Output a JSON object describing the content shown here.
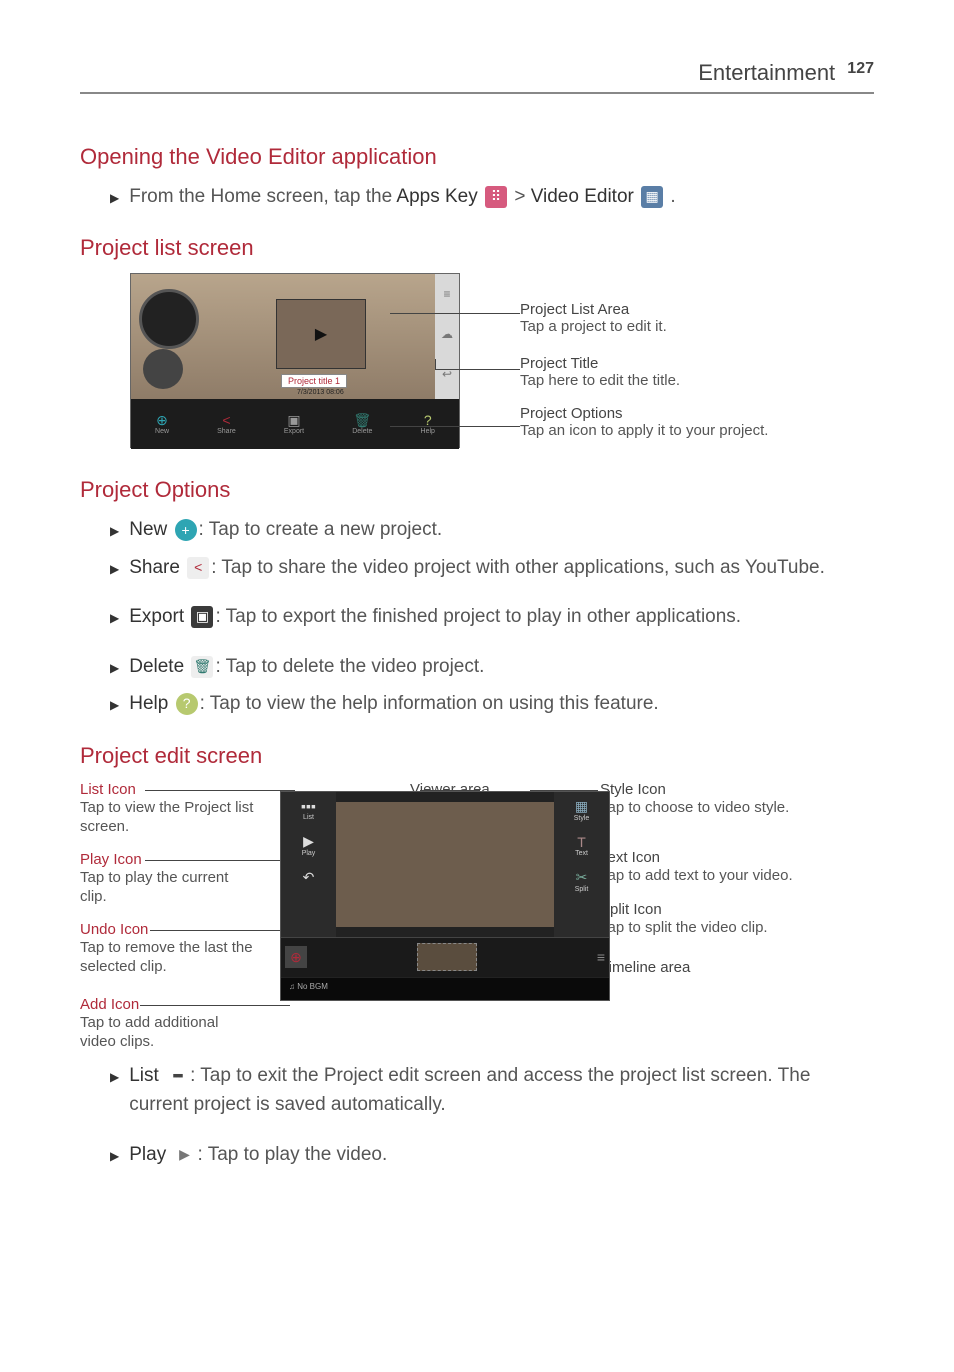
{
  "header": {
    "section": "Entertainment",
    "page": "127"
  },
  "h1": "Opening the Video Editor application",
  "intro": {
    "p1": "From the Home screen, tap the ",
    "apps": "Apps Key",
    "sep": " > ",
    "video": "Video Editor",
    "end": "."
  },
  "h2": "Project list screen",
  "diagram1": {
    "proj_title": "Project title 1",
    "proj_date": "7/3/2013 08:06",
    "btns": [
      {
        "ico": "⊕",
        "lbl": "New"
      },
      {
        "ico": "<",
        "lbl": "Share"
      },
      {
        "ico": "▣",
        "lbl": "Export"
      },
      {
        "ico": "🗑",
        "lbl": "Delete"
      },
      {
        "ico": "?",
        "lbl": "Help"
      }
    ],
    "c1t": "Project List Area",
    "c1d": "Tap a project to edit it.",
    "c2t": "Project Title",
    "c2d": "Tap here to edit the title.",
    "c3t": "Project Options",
    "c3d": "Tap an icon to apply it to your project."
  },
  "h3": "Project Options",
  "opts": {
    "new": {
      "label": "New",
      "desc": ": Tap to create a new project."
    },
    "share": {
      "label": "Share",
      "desc": ": Tap to share the video project with other applications, such as YouTube."
    },
    "export": {
      "label": "Export",
      "desc": ": Tap to export the finished project to play in other applications."
    },
    "delete": {
      "label": "Delete",
      "desc": ": Tap to delete the video project."
    },
    "help": {
      "label": "Help",
      "desc": ": Tap to view the help information on using this feature."
    }
  },
  "h4": "Project edit screen",
  "diagram2": {
    "list": {
      "t": "List Icon",
      "d": "Tap to view the Project list screen."
    },
    "play": {
      "t": "Play Icon",
      "d": "Tap to play the current clip."
    },
    "undo": {
      "t": "Undo Icon",
      "d": "Tap to remove the last the selected clip."
    },
    "add": {
      "t": "Add Icon",
      "d": "Tap to add additional video clips."
    },
    "viewer": {
      "t": "Viewer area"
    },
    "style": {
      "t": "Style Icon",
      "d": "Tap to choose to video style."
    },
    "text": {
      "t": "Text Icon",
      "d": "Tap to add text to your video."
    },
    "split": {
      "t": "Split Icon",
      "d": "Tap to split the video clip."
    },
    "timeline": {
      "t": "Timeline area"
    },
    "left_btns": [
      "List",
      "Play"
    ],
    "right_btns": [
      "Style",
      "Text",
      "Split"
    ],
    "audio": "♫ No BGM"
  },
  "bottom": {
    "list": {
      "label": "List",
      "desc": ": Tap to exit the Project edit screen and access the project list screen. The current project is saved automatically."
    },
    "play": {
      "label": "Play",
      "desc": ": Tap to play the video."
    }
  }
}
